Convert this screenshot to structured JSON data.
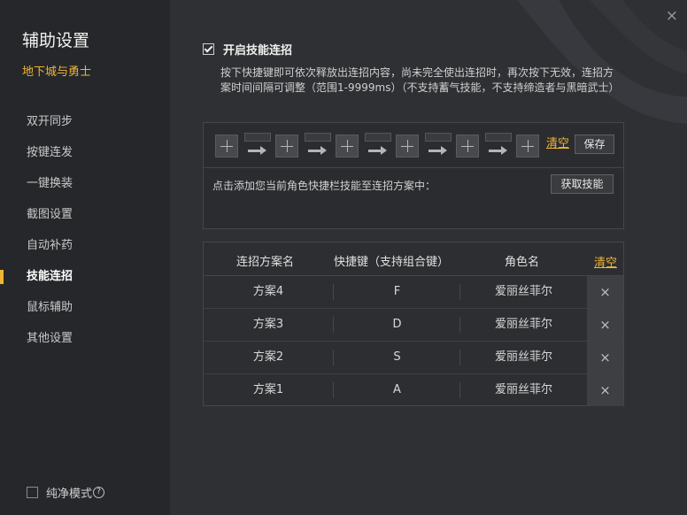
{
  "sidebar": {
    "title": "辅助设置",
    "game": "地下城与勇士",
    "items": [
      {
        "label": "双开同步"
      },
      {
        "label": "按键连发"
      },
      {
        "label": "一键换装"
      },
      {
        "label": "截图设置"
      },
      {
        "label": "自动补药"
      },
      {
        "label": "技能连招"
      },
      {
        "label": "鼠标辅助"
      },
      {
        "label": "其他设置"
      }
    ],
    "active_index": 5,
    "pure_mode": {
      "label": "纯净模式",
      "help": "?",
      "checked": false
    }
  },
  "main": {
    "close": "×",
    "enable": {
      "label": "开启技能连招",
      "checked": true
    },
    "description": "按下快捷键即可依次释放出连招内容，尚未完全使出连招时，再次按下无效，连招方案时间间隔可调整（范围1-9999ms）（不支持蓄气技能，不支持缔造者与黑暗武士）",
    "combo": {
      "slot_count": 6,
      "clear_label": "清空",
      "save_label": "保存",
      "hint": "点击添加您当前角色快捷栏技能至连招方案中：",
      "fetch_label": "获取技能"
    },
    "table": {
      "headers": {
        "name": "连招方案名",
        "hotkey": "快捷键（支持组合键）",
        "role": "角色名",
        "clear": "清空"
      },
      "rows": [
        {
          "name": "方案4",
          "hotkey": "F",
          "role": "爱丽丝菲尔",
          "delete": "×"
        },
        {
          "name": "方案3",
          "hotkey": "D",
          "role": "爱丽丝菲尔",
          "delete": "×"
        },
        {
          "name": "方案2",
          "hotkey": "S",
          "role": "爱丽丝菲尔",
          "delete": "×"
        },
        {
          "name": "方案1",
          "hotkey": "A",
          "role": "爱丽丝菲尔",
          "delete": "×"
        }
      ]
    }
  },
  "colors": {
    "accent": "#f2b533",
    "sidebar_bg": "#26272a",
    "main_bg": "#2f3033"
  }
}
